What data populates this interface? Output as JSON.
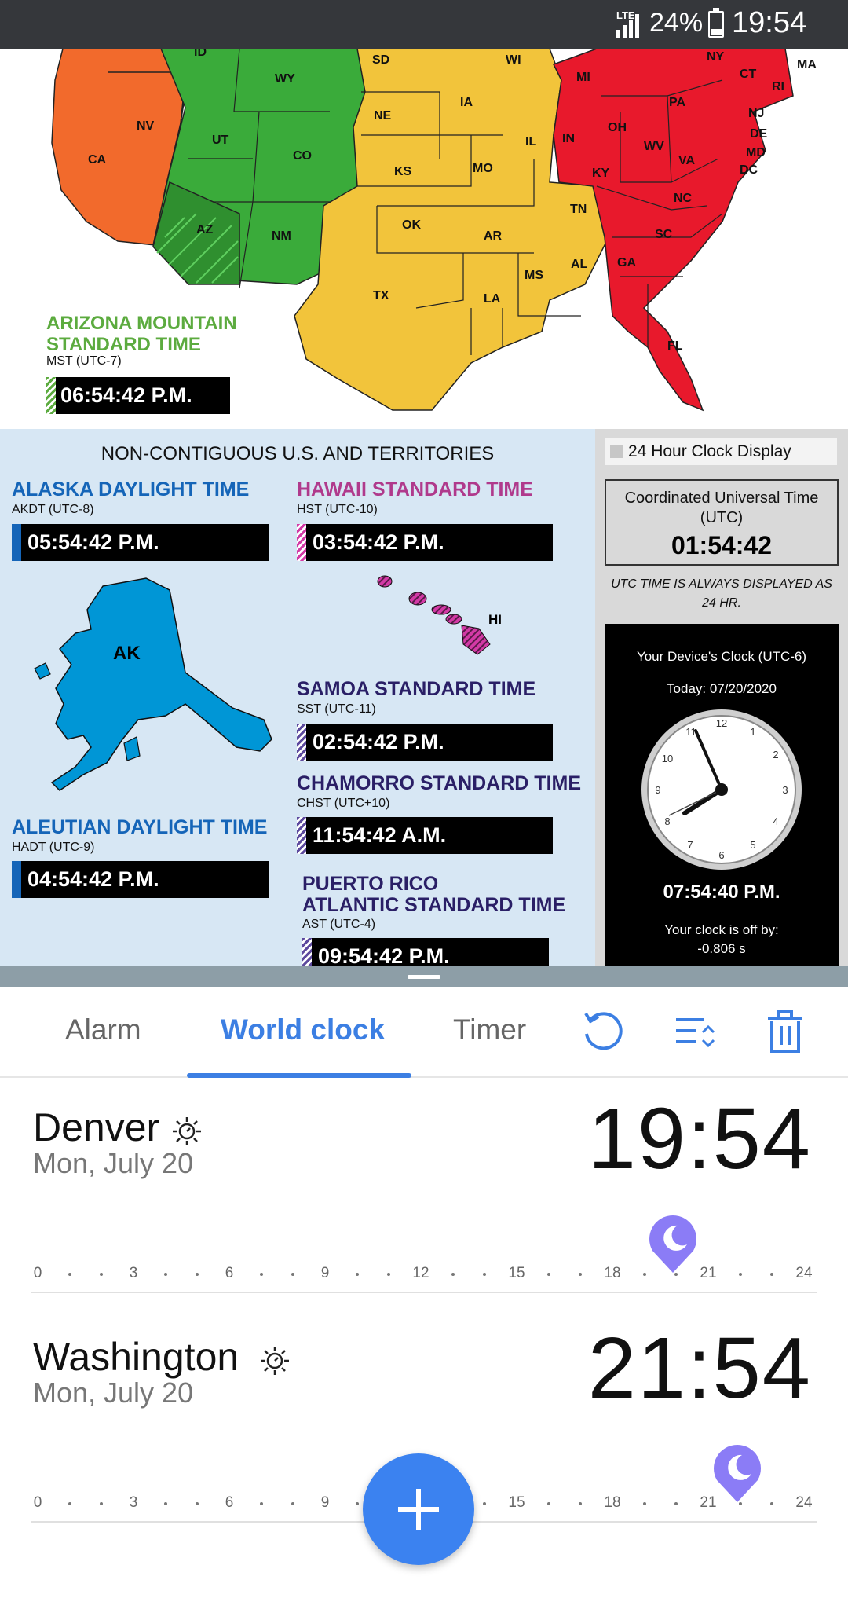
{
  "status_bar": {
    "network": "LTE",
    "battery": "24%",
    "time": "19:54"
  },
  "map": {
    "states": [
      "ID",
      "WY",
      "SD",
      "WI",
      "NY",
      "MA",
      "CT",
      "RI",
      "MI",
      "NV",
      "CA",
      "UT",
      "CO",
      "NE",
      "IA",
      "PA",
      "NJ",
      "DE",
      "MD",
      "DC",
      "OH",
      "IN",
      "IL",
      "WV",
      "VA",
      "KS",
      "MO",
      "KY",
      "AZ",
      "NM",
      "OK",
      "TN",
      "NC",
      "SC",
      "AR",
      "AL",
      "GA",
      "MS",
      "TX",
      "LA",
      "FL"
    ],
    "arizona": {
      "title_line1": "ARIZONA MOUNTAIN",
      "title_line2": "STANDARD TIME",
      "abbr": "MST (UTC-7)",
      "time": "06:54:42 P.M."
    }
  },
  "territories": {
    "heading": "NON-CONTIGUOUS U.S. AND TERRITORIES",
    "alaska": {
      "title": "ALASKA DAYLIGHT TIME",
      "abbr": "AKDT (UTC-8)",
      "time": "05:54:42 P.M.",
      "map_label": "AK"
    },
    "hawaii": {
      "title": "HAWAII STANDARD TIME",
      "abbr": "HST (UTC-10)",
      "time": "03:54:42 P.M.",
      "map_label": "HI"
    },
    "samoa": {
      "title": "SAMOA STANDARD TIME",
      "abbr": "SST (UTC-11)",
      "time": "02:54:42 P.M."
    },
    "chamorro": {
      "title": "CHAMORRO STANDARD TIME",
      "abbr": "CHST (UTC+10)",
      "time": "11:54:42 A.M."
    },
    "aleutian": {
      "title": "ALEUTIAN DAYLIGHT TIME",
      "abbr": "HADT (UTC-9)",
      "time": "04:54:42 P.M."
    },
    "puerto_rico": {
      "title_line1": "PUERTO RICO",
      "title_line2": "ATLANTIC STANDARD TIME",
      "abbr": "AST (UTC-4)",
      "time": "09:54:42 P.M."
    }
  },
  "side": {
    "checkbox_label": "24 Hour Clock Display",
    "utc_label": "Coordinated Universal Time (UTC)",
    "utc_time": "01:54:42",
    "utc_note": "UTC TIME IS ALWAYS DISPLAYED AS 24 HR.",
    "device_label": "Your Device's Clock (UTC-6)",
    "device_date": "Today: 07/20/2020",
    "device_time": "07:54:40 P.M.",
    "offset_label": "Your clock is off by:",
    "offset_value": "-0.806 s"
  },
  "tabs": {
    "alarm": "Alarm",
    "world_clock": "World clock",
    "timer": "Timer",
    "icons": [
      "refresh-icon",
      "sort-icon",
      "delete-icon"
    ]
  },
  "cities": [
    {
      "name": "Denver",
      "date": "Mon, July 20",
      "time": "19:54",
      "hour": 19.9
    },
    {
      "name": "Washington",
      "date": "Mon, July 20",
      "time": "21:54",
      "hour": 21.9
    }
  ],
  "timeline_ticks": [
    "0",
    "3",
    "6",
    "9",
    "12",
    "15",
    "18",
    "21",
    "24"
  ],
  "colors": {
    "accent": "#3c7fe3",
    "pin": "#8b7cf6",
    "pacific": "#f26a2c",
    "mountain": "#3aab3a",
    "central": "#f2c43b",
    "eastern": "#e8192c",
    "alaska": "#0096d6"
  }
}
